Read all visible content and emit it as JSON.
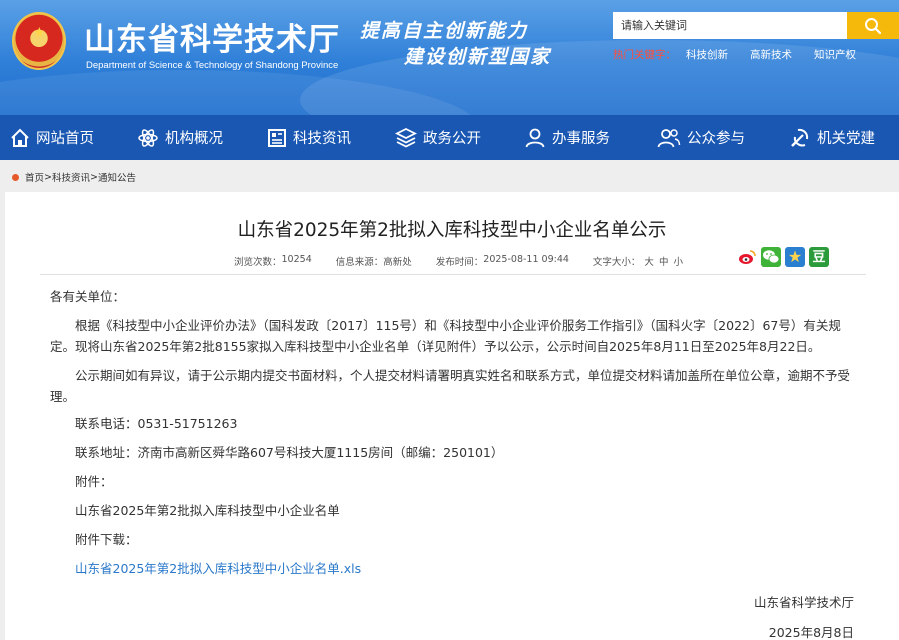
{
  "header": {
    "site_title": "山东省科学技术厅",
    "site_subtitle": "Department of Science & Technology of Shandong Province",
    "slogan_line1": "提高自主创新能力",
    "slogan_line2": "建设创新型国家",
    "search": {
      "placeholder": "请输入关键词",
      "button_icon": "search-icon"
    },
    "hotwords_label": "热门关键字：",
    "hotwords": [
      "科技创新",
      "高新技术",
      "知识产权"
    ]
  },
  "nav": {
    "items": [
      {
        "label": "网站首页",
        "icon": "home-icon"
      },
      {
        "label": "机构概况",
        "icon": "atom-icon"
      },
      {
        "label": "科技资讯",
        "icon": "news-icon"
      },
      {
        "label": "政务公开",
        "icon": "layers-icon"
      },
      {
        "label": "办事服务",
        "icon": "user-icon"
      },
      {
        "label": "公众参与",
        "icon": "people-icon"
      },
      {
        "label": "机关党建",
        "icon": "party-icon"
      }
    ]
  },
  "breadcrumb": [
    "首页",
    "科技资讯",
    "通知公告"
  ],
  "breadcrumb_sep": ">",
  "article": {
    "title": "山东省2025年第2批拟入库科技型中小企业名单公示",
    "meta": {
      "views_label": "浏览次数：",
      "views": "10254",
      "source_label": "信息来源：",
      "source": "高新处",
      "date_label": "发布时间：",
      "date": "2025-08-11 09:44",
      "fontsize_label": "文字大小：",
      "fontsize_options": [
        "大",
        "中",
        "小"
      ]
    },
    "share_icons": [
      "weibo-icon",
      "wechat-icon",
      "star-icon",
      "douban-icon"
    ],
    "salutation": "各有关单位：",
    "para1": "根据《科技型中小企业评价办法》（国科发政〔2017〕115号）和《科技型中小企业评价服务工作指引》（国科火字〔2022〕67号）有关规定。现将山东省2025年第2批8155家拟入库科技型中小企业名单（详见附件）予以公示，公示时间自2025年8月11日至2025年8月22日。",
    "para2": "公示期间如有异议，请于公示期内提交书面材料，个人提交材料请署明真实姓名和联系方式，单位提交材料请加盖所在单位公章，逾期不予受理。",
    "phone": "联系电话：0531-51751263",
    "address": "联系地址：济南市高新区舜华路607号科技大厦1115房间（邮编：250101）",
    "attachment_label": "附件：",
    "attachment_name": "山东省2025年第2批拟入库科技型中小企业名单",
    "download_label": "附件下载：",
    "download_link": "山东省2025年第2批拟入库科技型中小企业名单.xls",
    "signature": "山东省科学技术厅",
    "sign_date": "2025年8月8日"
  },
  "colors": {
    "banner": "#2f7fd8",
    "nav": "#1957b3",
    "search_button": "#f5b90c",
    "hot_label": "#ff4d3a",
    "link": "#2a78c9"
  }
}
